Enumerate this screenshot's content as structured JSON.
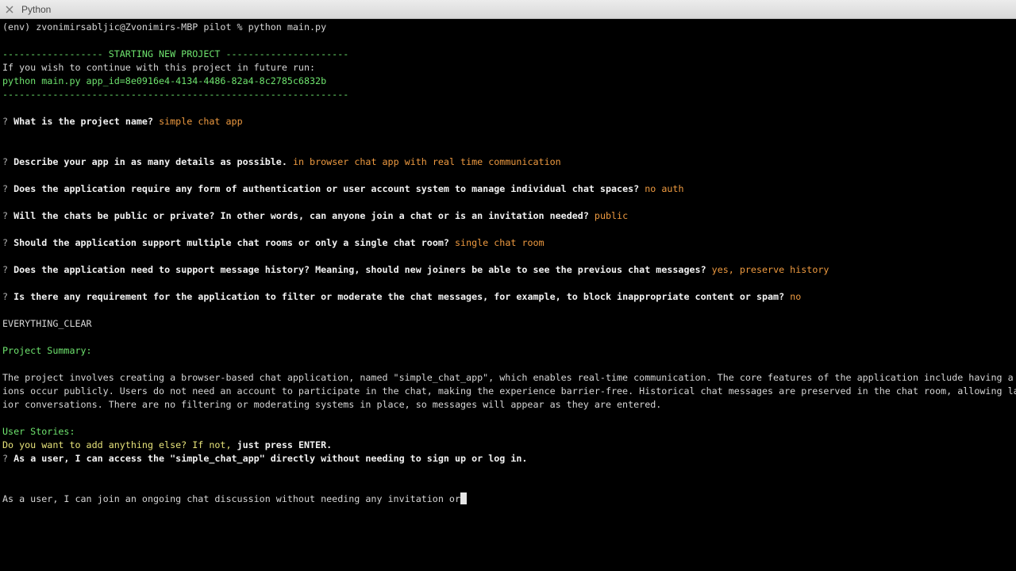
{
  "window": {
    "title": "Python"
  },
  "terminal": {
    "command_line": "(env) zvonimirsabljic@Zvonimirs-MBP pilot % python main.py",
    "banner_top": "------------------ STARTING NEW PROJECT ----------------------",
    "continue_hint": "If you wish to continue with this project in future run:",
    "continue_command": "python main.py app_id=8e0916e4-4134-4486-82a4-8c2785c6832b",
    "banner_bottom": "--------------------------------------------------------------",
    "prompt_mark": "?",
    "qa": [
      {
        "question": "What is the project name?",
        "answer": "simple chat app"
      },
      {
        "question": "Describe your app in as many details as possible.",
        "answer": "in browser chat app with real time communication"
      },
      {
        "question": "Does the application require any form of authentication or user account system to manage individual chat spaces?",
        "answer": "no auth"
      },
      {
        "question": "Will the chats be public or private? In other words, can anyone join a chat or is an invitation needed?",
        "answer": "public"
      },
      {
        "question": "Should the application support multiple chat rooms or only a single chat room?",
        "answer": "single chat room"
      },
      {
        "question": "Does the application need to support message history? Meaning, should new joiners be able to see the previous chat messages?",
        "answer": "yes, preserve history"
      },
      {
        "question": "Is there any requirement for the application to filter or moderate the chat messages, for example, to block inappropriate content or spam?",
        "answer": "no"
      }
    ],
    "status_line": "EVERYTHING_CLEAR",
    "summary_heading": "Project Summary:",
    "summary_lines": [
      "The project involves creating a browser-based chat application, named \"simple_chat_app\", which enables real-time communication. The core features of the application include having a s",
      "ions occur publicly. Users do not need an account to participate in the chat, making the experience barrier-free. Historical chat messages are preserved in the chat room, allowing lat",
      "ior conversations. There are no filtering or moderating systems in place, so messages will appear as they are entered."
    ],
    "stories_heading": "User Stories:",
    "add_prompt_prefix": "Do you want to add anything else? If not, ",
    "add_prompt_emphasis": "just press ENTER.",
    "story_prompt": "As a user, I can access the \"simple_chat_app\" directly without needing to sign up or log in.",
    "typing_line": "As a user, I can join an ongoing chat discussion without needing any invitation or"
  },
  "colors": {
    "background": "#000000",
    "text": "#d6d6d6",
    "green": "#6ee36e",
    "answer_orange": "#ee9a40",
    "hint_yellow": "#e6e27a"
  }
}
